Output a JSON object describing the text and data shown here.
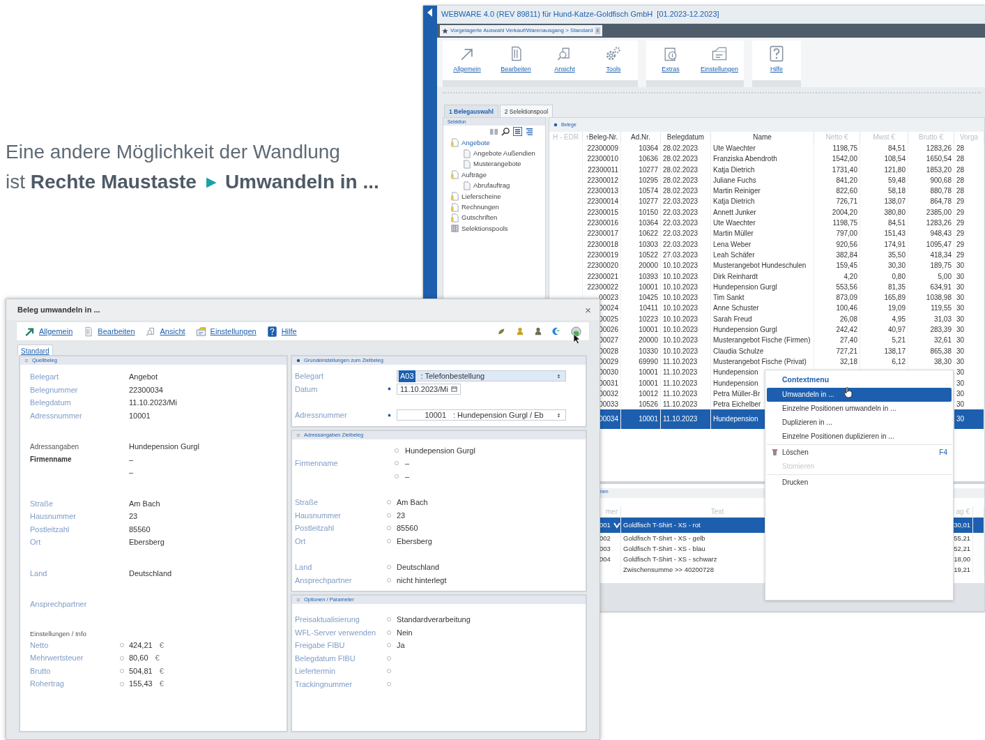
{
  "caption": {
    "line1": "Eine andere Möglichkeit der Wandlung",
    "line2_start": "ist **Rechte Maustaste**",
    "arrow": "▶",
    "line2_end": "**Umwandeln in ...**"
  },
  "app": {
    "title": "WEBWARE 4.0 (REV 89811) für Hund-Katze-Goldfisch GmbH  [01.2023-12.2023]",
    "doc_tab": {
      "label": "Vorgelagerte Auswahl Verkauf/Warenausgang > Standard",
      "close": "x"
    },
    "ribbon_groups": [
      [
        "Allgemein",
        "Bearbeiten",
        "Ansicht",
        "Tools"
      ],
      [
        "Extras",
        "Einstellungen"
      ],
      [
        "Hilfe"
      ]
    ],
    "tabs": [
      {
        "label": "1 Belegauswahl",
        "selected": true
      },
      {
        "label": "2 Selektionspool",
        "selected": false
      }
    ],
    "selection": {
      "title": "Selektion",
      "tree": [
        {
          "label": "Angebote",
          "selected": true,
          "children": [
            {
              "label": "Angebote Außendien",
              "selected": false
            },
            {
              "label": "Musterangebote",
              "selected": false
            }
          ]
        },
        {
          "label": "Aufträge",
          "selected": false,
          "children": [
            {
              "label": "Abrufauftrag",
              "selected": false
            }
          ]
        },
        {
          "label": "Lieferscheine",
          "selected": false
        },
        {
          "label": "Rechnungen",
          "selected": false
        },
        {
          "label": "Gutschriften",
          "selected": false
        },
        {
          "label": "Selektionspools",
          "selected": false
        }
      ]
    },
    "documents": {
      "title": "Belege",
      "columns": [
        "H - EDR",
        "↑Beleg-Nr.",
        "Ad.Nr.",
        "Belegdatum",
        "Name",
        "Netto €",
        "Mwst €",
        "Brutto €",
        "Vorga"
      ],
      "rows": [
        {
          "nr": "22300009",
          "adnr": "10364",
          "date": "28.02.2023",
          "name": "Ute Waechter",
          "netto": "1198,75",
          "mwst": "84,51",
          "brutto": "1283,26",
          "vorgang": "28",
          "selected": false
        },
        {
          "nr": "22300010",
          "adnr": "10636",
          "date": "28.02.2023",
          "name": "Franziska Abendroth",
          "netto": "1542,00",
          "mwst": "108,54",
          "brutto": "1650,54",
          "vorgang": "28",
          "selected": false
        },
        {
          "nr": "22300011",
          "adnr": "10277",
          "date": "28.02.2023",
          "name": "Katja Dietrich",
          "netto": "1731,40",
          "mwst": "121,80",
          "brutto": "1853,20",
          "vorgang": "28",
          "selected": false
        },
        {
          "nr": "22300012",
          "adnr": "10295",
          "date": "28.02.2023",
          "name": "Juliane Fuchs",
          "netto": "841,20",
          "mwst": "59,48",
          "brutto": "900,68",
          "vorgang": "28",
          "selected": false
        },
        {
          "nr": "22300013",
          "adnr": "10574",
          "date": "28.02.2023",
          "name": "Martin Reiniger",
          "netto": "822,60",
          "mwst": "58,18",
          "brutto": "880,78",
          "vorgang": "28",
          "selected": false
        },
        {
          "nr": "22300014",
          "adnr": "10277",
          "date": "22.03.2023",
          "name": "Katja Dietrich",
          "netto": "726,71",
          "mwst": "138,07",
          "brutto": "864,78",
          "vorgang": "29",
          "selected": false
        },
        {
          "nr": "22300015",
          "adnr": "10150",
          "date": "22.03.2023",
          "name": "Annett Junker",
          "netto": "2004,20",
          "mwst": "380,80",
          "brutto": "2385,00",
          "vorgang": "29",
          "selected": false
        },
        {
          "nr": "22300016",
          "adnr": "10364",
          "date": "22.03.2023",
          "name": "Ute Waechter",
          "netto": "1198,75",
          "mwst": "84,51",
          "brutto": "1283,26",
          "vorgang": "29",
          "selected": false
        },
        {
          "nr": "22300017",
          "adnr": "10622",
          "date": "22.03.2023",
          "name": "Martin Müller",
          "netto": "797,00",
          "mwst": "151,43",
          "brutto": "948,43",
          "vorgang": "29",
          "selected": false
        },
        {
          "nr": "22300018",
          "adnr": "10303",
          "date": "22.03.2023",
          "name": "Lena Weber",
          "netto": "920,56",
          "mwst": "174,91",
          "brutto": "1095,47",
          "vorgang": "29",
          "selected": false
        },
        {
          "nr": "22300019",
          "adnr": "10522",
          "date": "27.03.2023",
          "name": "Leah Schäfer",
          "netto": "382,84",
          "mwst": "35,50",
          "brutto": "418,34",
          "vorgang": "29",
          "selected": false
        },
        {
          "nr": "22300020",
          "adnr": "20000",
          "date": "10.10.2023",
          "name": "Musterangebot Hundeschulen",
          "netto": "159,45",
          "mwst": "30,30",
          "brutto": "189,75",
          "vorgang": "30",
          "selected": false
        },
        {
          "nr": "22300021",
          "adnr": "10393",
          "date": "10.10.2023",
          "name": "Dirk Reinhardt",
          "netto": "4,20",
          "mwst": "0,80",
          "brutto": "5,00",
          "vorgang": "30",
          "selected": false
        },
        {
          "nr": "22300022",
          "adnr": "10001",
          "date": "10.10.2023",
          "name": "Hundepension Gurgl",
          "netto": "553,56",
          "mwst": "81,35",
          "brutto": "634,91",
          "vorgang": "30",
          "selected": false
        },
        {
          "nr": "00023",
          "adnr": "10425",
          "date": "10.10.2023",
          "name": "Tim Sankt",
          "netto": "873,09",
          "mwst": "165,89",
          "brutto": "1038,98",
          "vorgang": "30",
          "selected": false
        },
        {
          "nr": "00024",
          "adnr": "10411",
          "date": "10.10.2023",
          "name": "Anne Schuster",
          "netto": "100,46",
          "mwst": "19,09",
          "brutto": "119,55",
          "vorgang": "30",
          "selected": false
        },
        {
          "nr": "00025",
          "adnr": "10223",
          "date": "10.10.2023",
          "name": "Sarah Freud",
          "netto": "26,08",
          "mwst": "4,95",
          "brutto": "31,03",
          "vorgang": "30",
          "selected": false
        },
        {
          "nr": "00026",
          "adnr": "10001",
          "date": "10.10.2023",
          "name": "Hundepension Gurgl",
          "netto": "242,42",
          "mwst": "40,97",
          "brutto": "283,39",
          "vorgang": "30",
          "selected": false
        },
        {
          "nr": "00027",
          "adnr": "20000",
          "date": "10.10.2023",
          "name": "Musterangebot Fische (Firmen)",
          "netto": "27,40",
          "mwst": "5,21",
          "brutto": "32,61",
          "vorgang": "30",
          "selected": false
        },
        {
          "nr": "00028",
          "adnr": "10330",
          "date": "10.10.2023",
          "name": "Claudia Schulze",
          "netto": "727,21",
          "mwst": "138,17",
          "brutto": "865,38",
          "vorgang": "30",
          "selected": false
        },
        {
          "nr": "00029",
          "adnr": "69990",
          "date": "11.10.2023",
          "name": "Musterangebot Fische (Privat)",
          "netto": "32,18",
          "mwst": "6,12",
          "brutto": "38,30",
          "vorgang": "30",
          "selected": false
        },
        {
          "nr": "00030",
          "adnr": "10001",
          "date": "11.10.2023",
          "name": "Hundepension",
          "vorgang": "30",
          "selected": false
        },
        {
          "nr": "00031",
          "adnr": "10001",
          "date": "11.10.2023",
          "name": "Hundepension",
          "vorgang": "30",
          "selected": false
        },
        {
          "nr": "00032",
          "adnr": "10012",
          "date": "11.10.2023",
          "name": "Petra Müller-Br",
          "vorgang": "30",
          "selected": false
        },
        {
          "nr": "00033",
          "adnr": "10526",
          "date": "11.10.2023",
          "name": "Petra Eichelber",
          "vorgang": "30",
          "selected": false
        },
        {
          "nr": "00034",
          "adnr": "10001",
          "date": "11.10.2023",
          "name": "Hundepension",
          "vorgang": "30",
          "selected": true
        }
      ]
    },
    "positions": {
      "tab": "nen",
      "columns": [
        "mer",
        "Text",
        "ag €"
      ],
      "rows": [
        {
          "nr": "001",
          "expanded": true,
          "text": "Goldfisch T-Shirt - XS - rot",
          "amount": "30,01",
          "selected": true
        },
        {
          "nr": "002",
          "expanded": false,
          "text": "Goldfisch T-Shirt - XS - gelb",
          "amount": "55,21",
          "selected": false
        },
        {
          "nr": "003",
          "expanded": false,
          "text": "Goldfisch T-Shirt - XS - blau",
          "amount": "52,21",
          "selected": false
        },
        {
          "nr": "004",
          "expanded": false,
          "text": "Goldfisch T-Shirt - XS - schwarz",
          "amount": "18,00",
          "selected": false
        },
        {
          "expanded": false,
          "text": "Zwischensumme >> 40200728",
          "amount": "19,21",
          "selected": false
        }
      ]
    }
  },
  "context_menu": {
    "title": "Contextmenu",
    "groups": [
      [
        {
          "label": "Umwandeln in ...",
          "selected": true,
          "disabled": false
        },
        {
          "label": "Einzelne Positionen umwandeln in ...",
          "selected": false,
          "disabled": false
        },
        {
          "label": "Duplizieren in ...",
          "selected": false,
          "disabled": false
        },
        {
          "label": "Einzelne Positionen duplizieren in ...",
          "selected": false,
          "disabled": false
        }
      ],
      [
        {
          "label": "Löschen",
          "shortcut": "F4",
          "selected": false,
          "disabled": false
        },
        {
          "label": "Stornieren",
          "selected": false,
          "disabled": true
        }
      ],
      [
        {
          "label": "Drucken",
          "selected": false,
          "disabled": false
        }
      ]
    ]
  },
  "dialog": {
    "title": "Beleg umwandeln in ...",
    "close": "×",
    "toolbar": [
      "Allgemein",
      "Bearbeiten",
      "Ansicht",
      "Einstellungen",
      "Hilfe"
    ],
    "tabs": [
      {
        "label": "Standard",
        "selected": true
      }
    ],
    "source": {
      "title": "Quellbeleg",
      "active": false,
      "groups": [
        [
          {
            "kind": "field",
            "label": "Belegart",
            "value": "Angebot"
          },
          {
            "kind": "field",
            "label": "Belegnummer",
            "value": "22300034"
          },
          {
            "kind": "field",
            "label": "Belegdatum",
            "value": "11.10.2023/Mi"
          },
          {
            "kind": "field",
            "label": "Adressnummer",
            "value": "10001"
          }
        ],
        [
          {
            "kind": "plain",
            "label": "Adressangaben",
            "value": "Hundepension Gurgl"
          },
          {
            "kind": "strong",
            "label": "Firmenname",
            "value": "–"
          },
          {
            "kind": "field",
            "value": "–"
          }
        ],
        [
          {
            "kind": "field",
            "label": "Straße",
            "value": "Am Bach"
          },
          {
            "kind": "field",
            "label": "Hausnummer",
            "value": "23"
          },
          {
            "kind": "field",
            "label": "Postleitzahl",
            "value": "85560"
          },
          {
            "kind": "field",
            "label": "Ort",
            "value": "Ebersberg"
          }
        ],
        [
          {
            "kind": "field",
            "label": "Land",
            "value": "Deutschland"
          }
        ],
        [
          {
            "kind": "field",
            "label": "Ansprechpartner"
          }
        ],
        [
          {
            "kind": "heading",
            "label": "Einstellungen / Info"
          },
          {
            "kind": "amount",
            "label": "Netto",
            "value": "424,21",
            "unit": "€"
          },
          {
            "kind": "amount",
            "label": "Mehrwertsteuer",
            "value": "80,60",
            "unit": "€"
          },
          {
            "kind": "amount",
            "label": "Brutto",
            "value": "504,81",
            "unit": "€"
          },
          {
            "kind": "amount",
            "label": "Rohertrag",
            "value": "155,43",
            "unit": "€"
          }
        ]
      ]
    },
    "target": [
      {
        "title": "Grundeinstellungen zum Zielbeleg",
        "active": true,
        "groups": [
          [
            {
              "kind": "select",
              "label": "Belegart",
              "required": false,
              "focused": true,
              "code": "A03",
              "code_highlighted": true,
              "value": ": Telefonbestellung"
            },
            {
              "kind": "date",
              "label": "Datum",
              "required": true,
              "value": "11.10.2023/Mi"
            }
          ],
          [
            {
              "kind": "select",
              "label": "Adressnummer",
              "required": true,
              "focused": false,
              "code": "10001",
              "code_highlighted": false,
              "value": ": Hundepension Gurgl / Eb"
            }
          ]
        ]
      },
      {
        "title": "Adressangaben Zielbeleg",
        "active": false,
        "groups": [
          [
            {
              "kind": "choice",
              "label": "Firmenname",
              "options": [
                "Hundepension Gurgl",
                "–",
                "–"
              ]
            }
          ],
          [
            {
              "kind": "option",
              "label": "Straße",
              "value": "Am Bach"
            },
            {
              "kind": "option",
              "label": "Hausnummer",
              "value": "23"
            },
            {
              "kind": "option",
              "label": "Postleitzahl",
              "value": "85560"
            },
            {
              "kind": "option",
              "label": "Ort",
              "value": "Ebersberg"
            }
          ],
          [
            {
              "kind": "option",
              "label": "Land",
              "value": "Deutschland"
            },
            {
              "kind": "option",
              "label": "Ansprechpartner",
              "value": "nicht hinterlegt"
            }
          ]
        ]
      },
      {
        "title": "Optionen / Parameter",
        "active": false,
        "groups": [
          [
            {
              "kind": "option",
              "label": "Preisaktualisierung",
              "value": "Standardverarbeitung"
            },
            {
              "kind": "option",
              "label": "WFL-Server verwenden",
              "value": "Nein"
            },
            {
              "kind": "option",
              "label": "Freigabe FIBU",
              "value": "Ja"
            },
            {
              "kind": "option",
              "label": "Belegdatum FIBU"
            },
            {
              "kind": "option",
              "label": "Liefertermin"
            },
            {
              "kind": "option",
              "label": "Trackingnummer"
            }
          ]
        ]
      }
    ]
  }
}
